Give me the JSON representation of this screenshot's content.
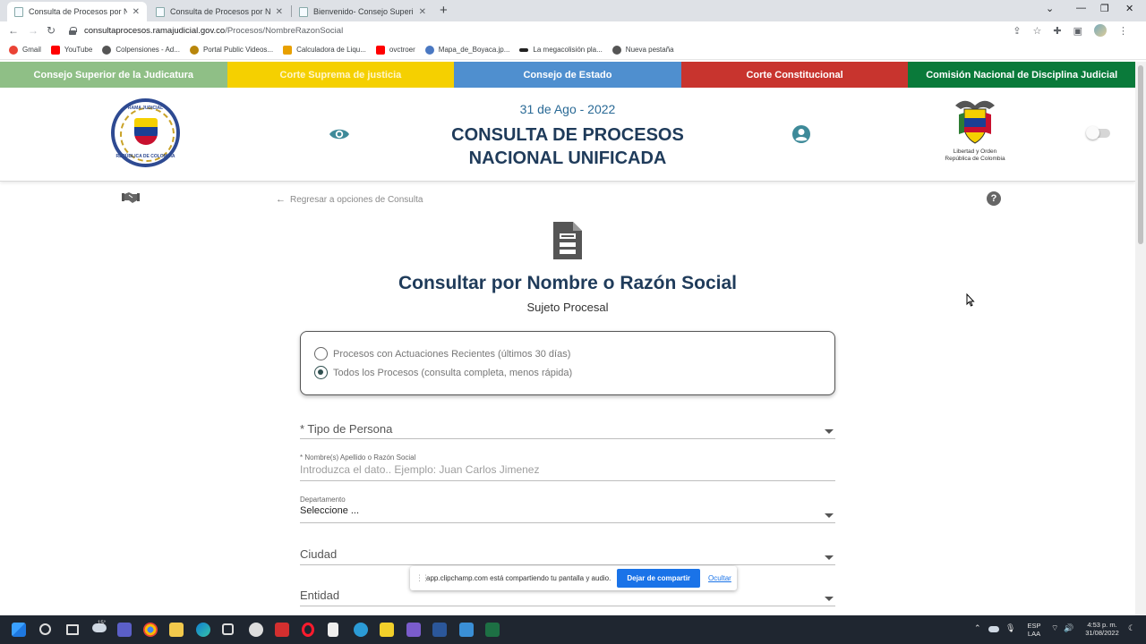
{
  "browser": {
    "tabs": [
      {
        "label": "Consulta de Procesos por Nombre",
        "active": true
      },
      {
        "label": "Consulta de Procesos por Nombre",
        "active": false
      },
      {
        "label": "Bienvenido- Consejo Superior de",
        "active": false
      }
    ],
    "url_host": "consultaprocesos.ramajudicial.gov.co",
    "url_path": "/Procesos/NombreRazonSocial",
    "bookmarks": [
      {
        "label": "Gmail",
        "color": "#ea4335"
      },
      {
        "label": "YouTube",
        "color": "#ff0000"
      },
      {
        "label": "Colpensiones - Ad...",
        "color": "#555555"
      },
      {
        "label": "Portal Public Videos...",
        "color": "#b8860b"
      },
      {
        "label": "Calculadora de Liqu...",
        "color": "#e8a000"
      },
      {
        "label": "ovctroer",
        "color": "#ff0000"
      },
      {
        "label": "Mapa_de_Boyaca.jp...",
        "color": "#4a78c2"
      },
      {
        "label": "La megacolisión pla...",
        "color": "#222222"
      },
      {
        "label": "Nueva pestaña",
        "color": "#555555"
      }
    ]
  },
  "courts": [
    {
      "label": "Consejo Superior de la Judicatura",
      "color": "#8fbf86"
    },
    {
      "label": "Corte Suprema de justicia",
      "color": "#f5d000"
    },
    {
      "label": "Consejo de Estado",
      "color": "#4f8fcf"
    },
    {
      "label": "Corte Constitucional",
      "color": "#c8342e"
    },
    {
      "label": "Comisión Nacional de Disciplina Judicial",
      "color": "#0a7a3a"
    }
  ],
  "header": {
    "date": "31 de Ago - 2022",
    "title_line1": "CONSULTA DE PROCESOS",
    "title_line2": "NACIONAL UNIFICADA",
    "logo_top": "RAMA JUDICIAL",
    "logo_bottom": "REPÚBLICA DE COLOMBIA",
    "coat_line1": "Libertad y Orden",
    "coat_line2": "República de Colombia"
  },
  "page": {
    "back_link": "Regresar a opciones de Consulta",
    "title": "Consultar por Nombre o Razón Social",
    "subtitle": "Sujeto Procesal",
    "radio_options": [
      {
        "label": "Procesos con Actuaciones Recientes (últimos 30 días)",
        "checked": false
      },
      {
        "label": "Todos los Procesos (consulta completa, menos rápida)",
        "checked": true
      }
    ],
    "fields": {
      "tipo_persona": {
        "label": "* Tipo de Persona"
      },
      "nombre": {
        "label": "* Nombre(s) Apellido o Razón Social",
        "placeholder": "Introduzca el dato.. Ejemplo: Juan Carlos Jimenez"
      },
      "departamento": {
        "label": "Departamento",
        "value": "Seleccione ..."
      },
      "ciudad": {
        "label": "Ciudad"
      },
      "entidad": {
        "label": "Entidad"
      }
    }
  },
  "share_notice": {
    "text": "app.clipchamp.com está compartiendo tu pantalla y audio.",
    "stop": "Dejar de compartir",
    "hide": "Ocultar"
  },
  "taskbar": {
    "weather": "15°",
    "lang_line1": "ESP",
    "lang_line2": "LAA",
    "time": "4:53 p. m.",
    "date": "31/08/2022"
  }
}
